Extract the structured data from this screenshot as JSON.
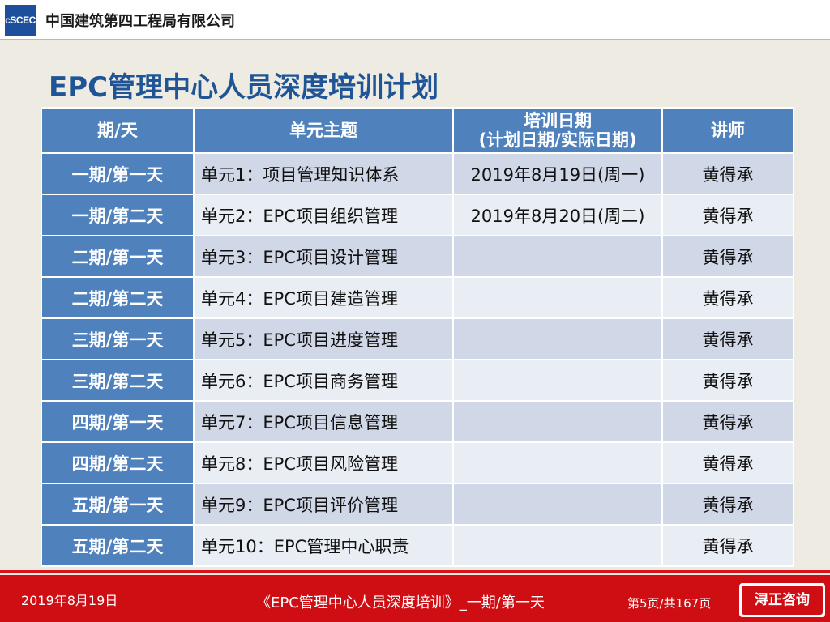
{
  "header": {
    "logo_text": "cSCEC",
    "company": "中国建筑第四工程局有限公司"
  },
  "slide": {
    "title": "EPC管理中心人员深度培训计划"
  },
  "table": {
    "headers": {
      "period": "期/天",
      "topic": "单元主题",
      "date_line1": "培训日期",
      "date_line2": "(计划日期/实际日期)",
      "teacher": "讲师"
    },
    "rows": [
      {
        "period": "一期/第一天",
        "topic": "单元1：项目管理知识体系",
        "date": "2019年8月19日(周一)",
        "teacher": "黄得承"
      },
      {
        "period": "一期/第二天",
        "topic": "单元2：EPC项目组织管理",
        "date": "2019年8月20日(周二)",
        "teacher": "黄得承"
      },
      {
        "period": "二期/第一天",
        "topic": "单元3：EPC项目设计管理",
        "date": "",
        "teacher": "黄得承"
      },
      {
        "period": "二期/第二天",
        "topic": "单元4：EPC项目建造管理",
        "date": "",
        "teacher": "黄得承"
      },
      {
        "period": "三期/第一天",
        "topic": "单元5：EPC项目进度管理",
        "date": "",
        "teacher": "黄得承"
      },
      {
        "period": "三期/第二天",
        "topic": "单元6：EPC项目商务管理",
        "date": "",
        "teacher": "黄得承"
      },
      {
        "period": "四期/第一天",
        "topic": "单元7：EPC项目信息管理",
        "date": "",
        "teacher": "黄得承"
      },
      {
        "period": "四期/第二天",
        "topic": "单元8：EPC项目风险管理",
        "date": "",
        "teacher": "黄得承"
      },
      {
        "period": "五期/第一天",
        "topic": "单元9：EPC项目评价管理",
        "date": "",
        "teacher": "黄得承"
      },
      {
        "period": "五期/第二天",
        "topic": "单元10：EPC管理中心职责",
        "date": "",
        "teacher": "黄得承"
      }
    ]
  },
  "footer": {
    "date": "2019年8月19日",
    "course": "《EPC管理中心人员深度培训》_一期/第一天",
    "page": "第5页/共167页",
    "badge": "浔正咨询"
  },
  "colors": {
    "title": "#1f5596",
    "header_cell": "#4f81bd",
    "row_odd": "#d0d8e8",
    "row_even": "#e9edf4",
    "footer": "#cf0e14"
  }
}
